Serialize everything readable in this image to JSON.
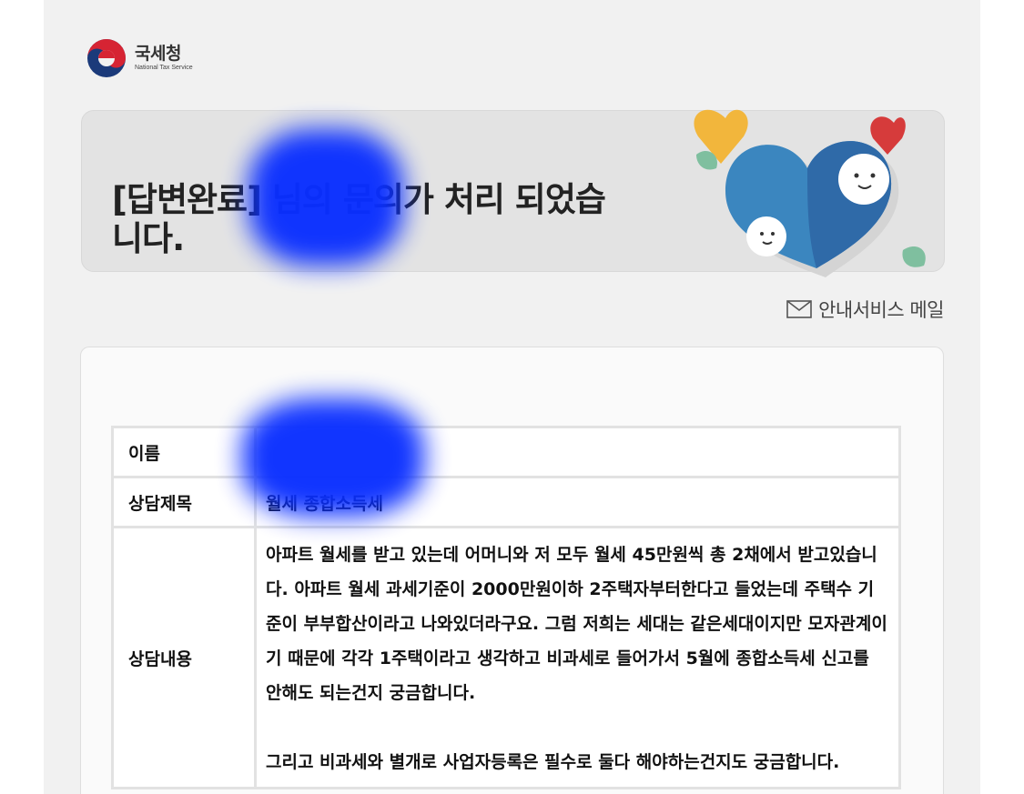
{
  "header": {
    "logo_ko": "국세청",
    "logo_en": "National Tax Service"
  },
  "banner": {
    "title": "[답변완료] 님의 문의가 처리 되었습니다."
  },
  "mail_label": "안내서비스 메일",
  "consultation": {
    "name_label": "이름",
    "name_value": "",
    "subject_label": "상담제목",
    "subject_value": "월세 종합소득세",
    "content_label": "상담내용",
    "content_value": "아파트 월세를 받고 있는데 어머니와 저 모두 월세 45만원씩 총 2채에서 받고있습니다. 아파트 월세 과세기준이 2000만원이하 2주택자부터한다고 들었는데 주택수 기준이 부부합산이라고 나와있더라구요. 그럼 저희는 세대는 같은세대이지만 모자관계이기 때문에 각각 1주택이라고 생각하고 비과세로 들어가서 5월에 종합소득세 신고를 안해도 되는건지 궁금합니다.\n\n그리고 비과세와 별개로 사업자등록은 필수로 둘다 해야하는건지도 궁금합니다."
  },
  "colors": {
    "background": "#f1f1f1",
    "banner": "#e3e3e3",
    "redaction": "#0a2fff"
  }
}
